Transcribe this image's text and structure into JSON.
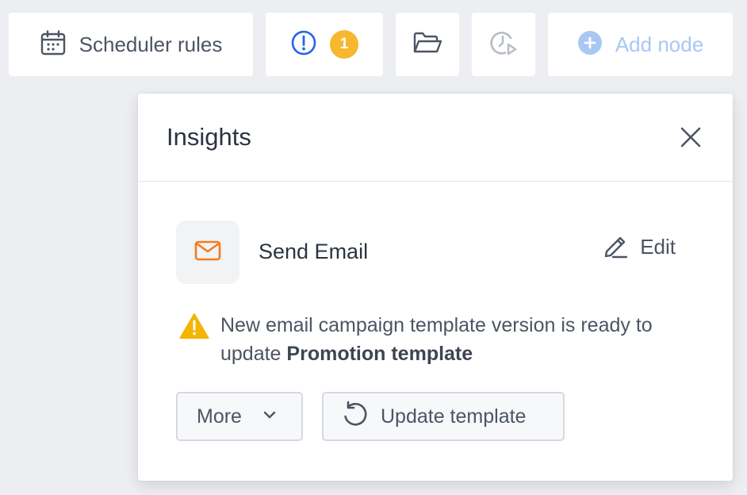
{
  "toolbar": {
    "scheduler_label": "Scheduler rules",
    "alerts_count": "1",
    "add_node_label": "Add node"
  },
  "insights": {
    "title": "Insights",
    "node": {
      "name": "Send Email",
      "edit_label": "Edit"
    },
    "warning": {
      "message": "New email campaign template version is ready to update",
      "template_name": "Promotion template"
    },
    "more_label": "More",
    "update_label": "Update template"
  },
  "colors": {
    "background": "#eceef1",
    "alert_blue": "#2563eb",
    "badge_yellow": "#f5b82e",
    "email_orange": "#f47b20",
    "warning_yellow": "#f5b400",
    "add_node_blue": "#a9c7f4"
  },
  "icons": {
    "scheduler": "calendar-icon",
    "alerts": "exclamation-circle-icon",
    "open": "folder-open-icon",
    "history": "clock-play-icon",
    "add": "plus-circle-icon",
    "close": "close-icon",
    "node": "envelope-icon",
    "edit": "pencil-icon",
    "warning": "warning-triangle-icon",
    "more": "chevron-down-icon",
    "update": "refresh-icon"
  }
}
